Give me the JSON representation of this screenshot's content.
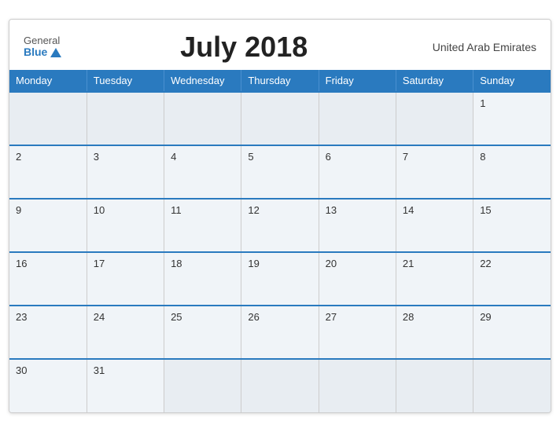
{
  "header": {
    "logo_general": "General",
    "logo_blue": "Blue",
    "title": "July 2018",
    "country": "United Arab Emirates"
  },
  "weekdays": [
    "Monday",
    "Tuesday",
    "Wednesday",
    "Thursday",
    "Friday",
    "Saturday",
    "Sunday"
  ],
  "weeks": [
    [
      "",
      "",
      "",
      "",
      "",
      "",
      "1"
    ],
    [
      "2",
      "3",
      "4",
      "5",
      "6",
      "7",
      "8"
    ],
    [
      "9",
      "10",
      "11",
      "12",
      "13",
      "14",
      "15"
    ],
    [
      "16",
      "17",
      "18",
      "19",
      "20",
      "21",
      "22"
    ],
    [
      "23",
      "24",
      "25",
      "26",
      "27",
      "28",
      "29"
    ],
    [
      "30",
      "31",
      "",
      "",
      "",
      "",
      ""
    ]
  ]
}
